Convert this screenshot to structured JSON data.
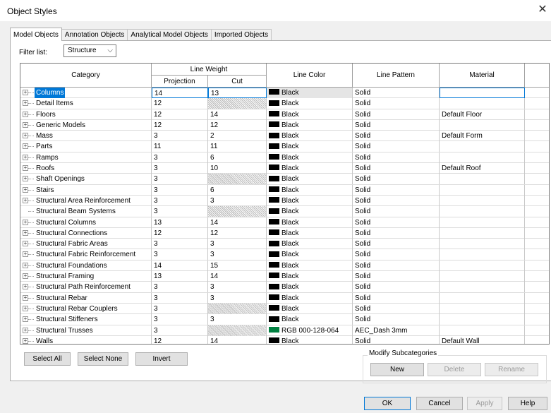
{
  "window": {
    "title": "Object Styles",
    "close_glyph": "✕"
  },
  "tabs": [
    {
      "label": "Model Objects",
      "active": true
    },
    {
      "label": "Annotation Objects",
      "active": false
    },
    {
      "label": "Analytical Model Objects",
      "active": false
    },
    {
      "label": "Imported Objects",
      "active": false
    }
  ],
  "filter": {
    "label": "Filter list:",
    "value": "Structure"
  },
  "grid": {
    "headers": {
      "category": "Category",
      "line_weight": "Line Weight",
      "projection": "Projection",
      "cut": "Cut",
      "line_color": "Line Color",
      "line_pattern": "Line Pattern",
      "material": "Material"
    },
    "rows": [
      {
        "category": "Columns",
        "expandable": true,
        "projection": "14",
        "cut": "13",
        "color_name": "Black",
        "color_hex": "#000000",
        "pattern": "Solid",
        "material": "",
        "selected": true
      },
      {
        "category": "Detail Items",
        "expandable": true,
        "projection": "12",
        "cut": "",
        "cut_na": true,
        "color_name": "Black",
        "color_hex": "#000000",
        "pattern": "Solid",
        "material": ""
      },
      {
        "category": "Floors",
        "expandable": true,
        "projection": "12",
        "cut": "14",
        "color_name": "Black",
        "color_hex": "#000000",
        "pattern": "Solid",
        "material": "Default Floor"
      },
      {
        "category": "Generic Models",
        "expandable": true,
        "projection": "12",
        "cut": "12",
        "color_name": "Black",
        "color_hex": "#000000",
        "pattern": "Solid",
        "material": ""
      },
      {
        "category": "Mass",
        "expandable": true,
        "projection": "3",
        "cut": "2",
        "color_name": "Black",
        "color_hex": "#000000",
        "pattern": "Solid",
        "material": "Default Form"
      },
      {
        "category": "Parts",
        "expandable": true,
        "projection": "11",
        "cut": "11",
        "color_name": "Black",
        "color_hex": "#000000",
        "pattern": "Solid",
        "material": ""
      },
      {
        "category": "Ramps",
        "expandable": true,
        "projection": "3",
        "cut": "6",
        "color_name": "Black",
        "color_hex": "#000000",
        "pattern": "Solid",
        "material": ""
      },
      {
        "category": "Roofs",
        "expandable": true,
        "projection": "3",
        "cut": "10",
        "color_name": "Black",
        "color_hex": "#000000",
        "pattern": "Solid",
        "material": "Default Roof"
      },
      {
        "category": "Shaft Openings",
        "expandable": true,
        "projection": "3",
        "cut": "",
        "cut_na": true,
        "color_name": "Black",
        "color_hex": "#000000",
        "pattern": "Solid",
        "material": ""
      },
      {
        "category": "Stairs",
        "expandable": true,
        "projection": "3",
        "cut": "6",
        "color_name": "Black",
        "color_hex": "#000000",
        "pattern": "Solid",
        "material": ""
      },
      {
        "category": "Structural Area Reinforcement",
        "expandable": true,
        "projection": "3",
        "cut": "3",
        "color_name": "Black",
        "color_hex": "#000000",
        "pattern": "Solid",
        "material": ""
      },
      {
        "category": "Structural Beam Systems",
        "expandable": false,
        "projection": "3",
        "cut": "",
        "cut_na": true,
        "color_name": "Black",
        "color_hex": "#000000",
        "pattern": "Solid",
        "material": ""
      },
      {
        "category": "Structural Columns",
        "expandable": true,
        "projection": "13",
        "cut": "14",
        "color_name": "Black",
        "color_hex": "#000000",
        "pattern": "Solid",
        "material": ""
      },
      {
        "category": "Structural Connections",
        "expandable": true,
        "projection": "12",
        "cut": "12",
        "color_name": "Black",
        "color_hex": "#000000",
        "pattern": "Solid",
        "material": ""
      },
      {
        "category": "Structural Fabric Areas",
        "expandable": true,
        "projection": "3",
        "cut": "3",
        "color_name": "Black",
        "color_hex": "#000000",
        "pattern": "Solid",
        "material": ""
      },
      {
        "category": "Structural Fabric Reinforcement",
        "expandable": true,
        "projection": "3",
        "cut": "3",
        "color_name": "Black",
        "color_hex": "#000000",
        "pattern": "Solid",
        "material": ""
      },
      {
        "category": "Structural Foundations",
        "expandable": true,
        "projection": "14",
        "cut": "15",
        "color_name": "Black",
        "color_hex": "#000000",
        "pattern": "Solid",
        "material": ""
      },
      {
        "category": "Structural Framing",
        "expandable": true,
        "projection": "13",
        "cut": "14",
        "color_name": "Black",
        "color_hex": "#000000",
        "pattern": "Solid",
        "material": ""
      },
      {
        "category": "Structural Path Reinforcement",
        "expandable": true,
        "projection": "3",
        "cut": "3",
        "color_name": "Black",
        "color_hex": "#000000",
        "pattern": "Solid",
        "material": ""
      },
      {
        "category": "Structural Rebar",
        "expandable": true,
        "projection": "3",
        "cut": "3",
        "color_name": "Black",
        "color_hex": "#000000",
        "pattern": "Solid",
        "material": ""
      },
      {
        "category": "Structural Rebar Couplers",
        "expandable": true,
        "projection": "3",
        "cut": "",
        "cut_na": true,
        "color_name": "Black",
        "color_hex": "#000000",
        "pattern": "Solid",
        "material": ""
      },
      {
        "category": "Structural Stiffeners",
        "expandable": true,
        "projection": "3",
        "cut": "3",
        "color_name": "Black",
        "color_hex": "#000000",
        "pattern": "Solid",
        "material": ""
      },
      {
        "category": "Structural Trusses",
        "expandable": true,
        "projection": "3",
        "cut": "",
        "cut_na": true,
        "color_name": "RGB 000-128-064",
        "color_hex": "#008040",
        "pattern": "AEC_Dash 3mm",
        "material": ""
      },
      {
        "category": "Walls",
        "expandable": true,
        "projection": "12",
        "cut": "14",
        "color_name": "Black",
        "color_hex": "#000000",
        "pattern": "Solid",
        "material": "Default Wall"
      }
    ]
  },
  "selection_buttons": {
    "select_all": "Select All",
    "select_none": "Select None",
    "invert": "Invert"
  },
  "modify_subcategories": {
    "label": "Modify Subcategories",
    "new": "New",
    "delete": "Delete",
    "rename": "Rename"
  },
  "footer": {
    "ok": "OK",
    "cancel": "Cancel",
    "apply": "Apply",
    "help": "Help"
  }
}
